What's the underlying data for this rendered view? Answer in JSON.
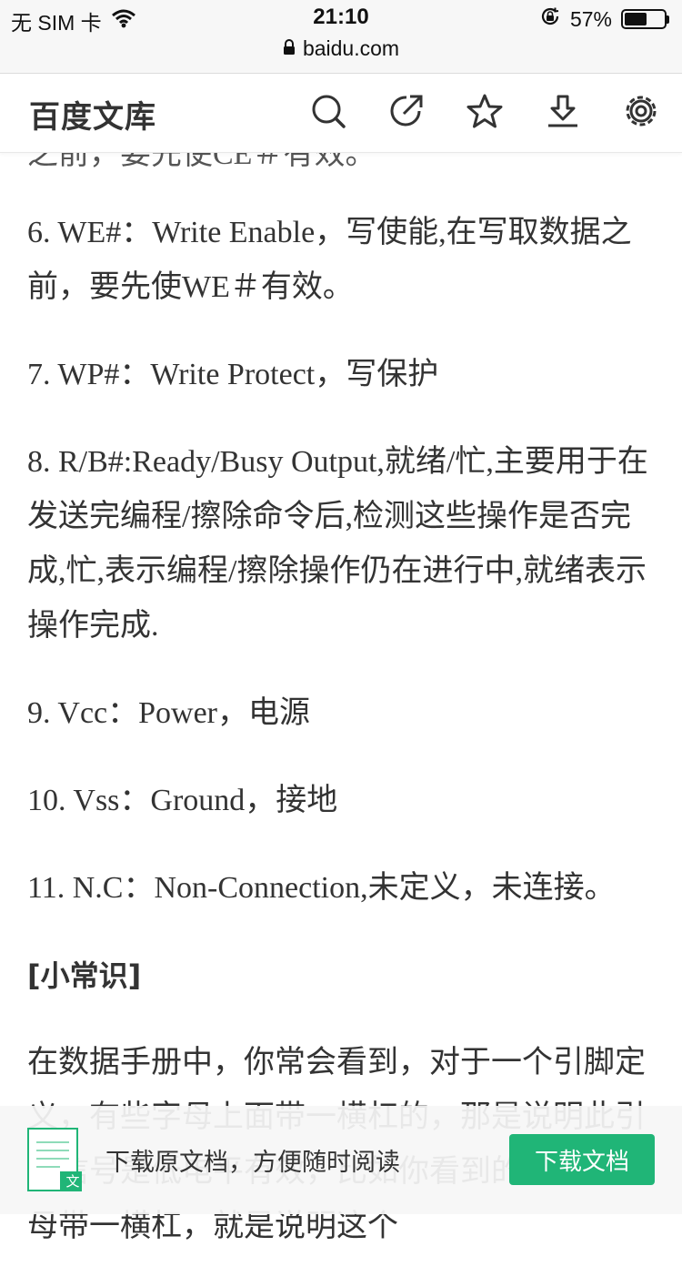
{
  "status_bar": {
    "carrier": "无 SIM 卡",
    "time": "21:10",
    "url": "baidu.com",
    "battery": "57%",
    "battery_level": 0.57
  },
  "header": {
    "title": "百度文库",
    "icons": [
      "search-icon",
      "share-icon",
      "star-icon",
      "download-icon",
      "settings-icon"
    ]
  },
  "content": {
    "cut_line": "之前，要先使CE＃有效。",
    "items": [
      "6. WE#：Write Enable，写使能,在写取数据之前，要先使WE＃有效。",
      "7. WP#：Write Protect，写保护",
      "8. R/B#:Ready/Busy Output,就绪/忙,主要用于在发送完编程/擦除命令后,检测这些操作是否完成,忙,表示编程/擦除操作仍在进行中,就绪表示操作完成.",
      "9. Vcc：Power，电源",
      "10. Vss：Ground，接地",
      "11. N.C：Non-Connection,未定义，未连接。"
    ],
    "section_title": "[小常识]",
    "paragraph": "在数据手册中，你常会看到，对于一个引脚定义，有些字母上面带一横杠的，那是说明此引脚信号是低电平有效，比如你",
    "paragraph_tail": "看到的，有个字母带一横杠，就是说明这个"
  },
  "download_bar": {
    "doc_badge": "文",
    "text": "下载原文档，方便随时阅读",
    "button_label": "下载文档"
  },
  "colors": {
    "accent": "#20b577",
    "text": "#333333"
  }
}
